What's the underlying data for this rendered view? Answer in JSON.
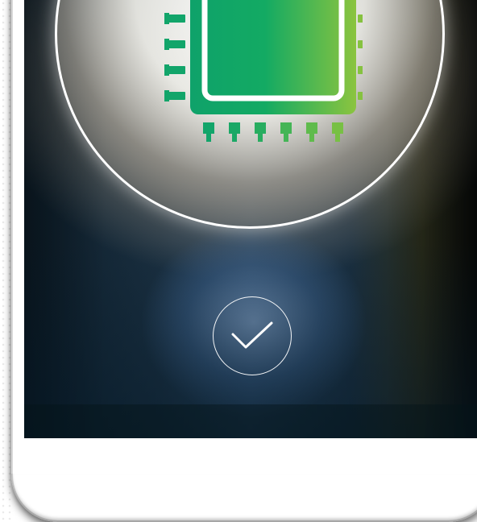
{
  "illustration": {
    "chip_icon": "cpu-chip-icon",
    "confirm_icon": "checkmark-icon"
  },
  "colors": {
    "chip_gradient_start": "#0fa26a",
    "chip_gradient_end": "#8bc43f",
    "screen_dark": "#0d1e2a",
    "screen_mid": "#24405a",
    "phone_body": "#ffffff"
  }
}
